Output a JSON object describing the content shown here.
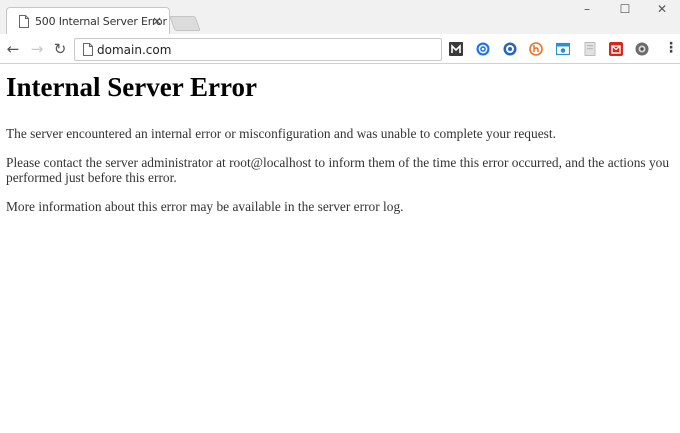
{
  "tab": {
    "title": "500 Internal Server Error",
    "close_glyph": "×"
  },
  "window_controls": {
    "minimize": "–",
    "maximize": "☐",
    "close": "✕"
  },
  "toolbar": {
    "back_glyph": "←",
    "forward_glyph": "→",
    "reload_glyph": "↻",
    "url": "domain.com",
    "menu_glyph": "⋮",
    "extensions": [
      {
        "name": "m-extension-icon",
        "color": "#3a3a3a"
      },
      {
        "name": "at-blue-extension-icon",
        "color": "#1a73e8"
      },
      {
        "name": "a-blue-extension-icon",
        "color": "#2563c9"
      },
      {
        "name": "b-orange-extension-icon",
        "color": "#f2701e"
      },
      {
        "name": "screen-capture-extension-icon",
        "color": "#2b8fd6"
      },
      {
        "name": "page-grey-extension-icon",
        "color": "#bdbdbd"
      },
      {
        "name": "red-box-extension-icon",
        "color": "#d9261c"
      },
      {
        "name": "grey-circle-extension-icon",
        "color": "#6b6b6b"
      }
    ]
  },
  "page": {
    "heading": "Internal Server Error",
    "paragraph1": "The server encountered an internal error or misconfiguration and was unable to complete your request.",
    "paragraph2": "Please contact the server administrator at root@localhost to inform them of the time this error occurred, and the actions you performed just before this error.",
    "paragraph3": "More information about this error may be available in the server error log."
  }
}
